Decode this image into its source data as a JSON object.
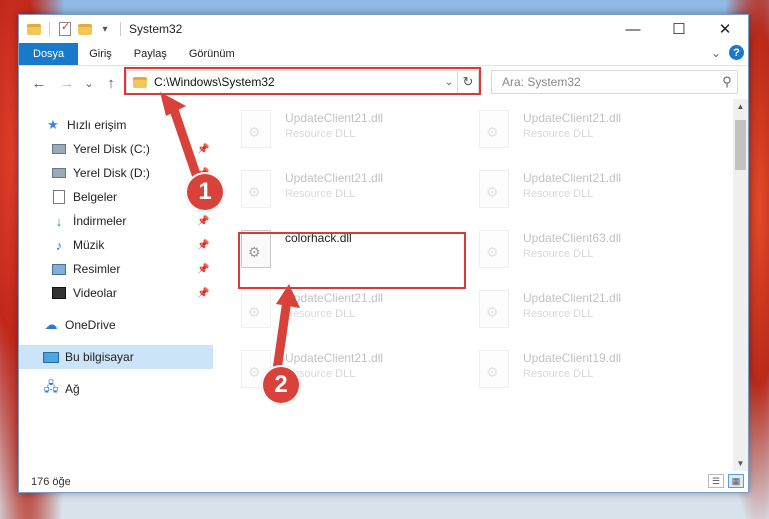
{
  "window": {
    "title": "System32",
    "controls": {
      "minimize": "—",
      "maximize": "☐",
      "close": "✕"
    }
  },
  "ribbon": {
    "tabs": [
      "Dosya",
      "Giriş",
      "Paylaş",
      "Görünüm"
    ],
    "expand_glyph": "⌄",
    "help_glyph": "?"
  },
  "navigation": {
    "back_glyph": "←",
    "forward_glyph": "→",
    "recent_glyph": "⌄",
    "up_glyph": "↑",
    "address": "C:\\Windows\\System32",
    "address_dropdown_glyph": "⌄",
    "refresh_glyph": "↻",
    "search_placeholder": "Ara: System32",
    "search_icon_glyph": "⚲"
  },
  "sidebar": {
    "items": [
      {
        "label": "Hızlı erişim",
        "icon": "star-icon",
        "pinned": false,
        "selected": false
      },
      {
        "label": "Yerel Disk (C:)",
        "icon": "drive-icon",
        "pinned": true,
        "selected": false
      },
      {
        "label": "Yerel Disk (D:)",
        "icon": "drive-icon",
        "pinned": true,
        "selected": false
      },
      {
        "label": "Belgeler",
        "icon": "documents-icon",
        "pinned": true,
        "selected": false
      },
      {
        "label": "İndirmeler",
        "icon": "download-icon",
        "pinned": true,
        "selected": false
      },
      {
        "label": "Müzik",
        "icon": "music-icon",
        "pinned": true,
        "selected": false
      },
      {
        "label": "Resimler",
        "icon": "pictures-icon",
        "pinned": true,
        "selected": false
      },
      {
        "label": "Videolar",
        "icon": "videos-icon",
        "pinned": true,
        "selected": false
      },
      {
        "label": "OneDrive",
        "icon": "cloud-icon",
        "pinned": false,
        "selected": false
      },
      {
        "label": "Bu bilgisayar",
        "icon": "computer-icon",
        "pinned": false,
        "selected": true
      },
      {
        "label": "Ağ",
        "icon": "network-icon",
        "pinned": false,
        "selected": false
      }
    ],
    "pin_glyph": "📌"
  },
  "files": [
    {
      "name": "UpdateClient21.dll",
      "type": "Resource DLL",
      "faded": true
    },
    {
      "name": "UpdateClient21.dll",
      "type": "Resource DLL",
      "faded": true
    },
    {
      "name": "UpdateClient21.dll",
      "type": "Resource DLL",
      "faded": true
    },
    {
      "name": "UpdateClient21.dll",
      "type": "Resource DLL",
      "faded": true
    },
    {
      "name": "colorhack.dll",
      "type": "",
      "faded": false
    },
    {
      "name": "UpdateClient63.dll",
      "type": "Resource DLL",
      "faded": true
    },
    {
      "name": "UpdateClient21.dll",
      "type": "Resource DLL",
      "faded": true
    },
    {
      "name": "UpdateClient21.dll",
      "type": "Resource DLL",
      "faded": true
    },
    {
      "name": "UpdateClient21.dll",
      "type": "Resource DLL",
      "faded": true
    },
    {
      "name": "UpdateClient19.dll",
      "type": "Resource DLL",
      "faded": true
    }
  ],
  "status": {
    "count": "176 öğe"
  },
  "annotations": {
    "step1": "1",
    "step2": "2",
    "color": "#d9413b"
  }
}
